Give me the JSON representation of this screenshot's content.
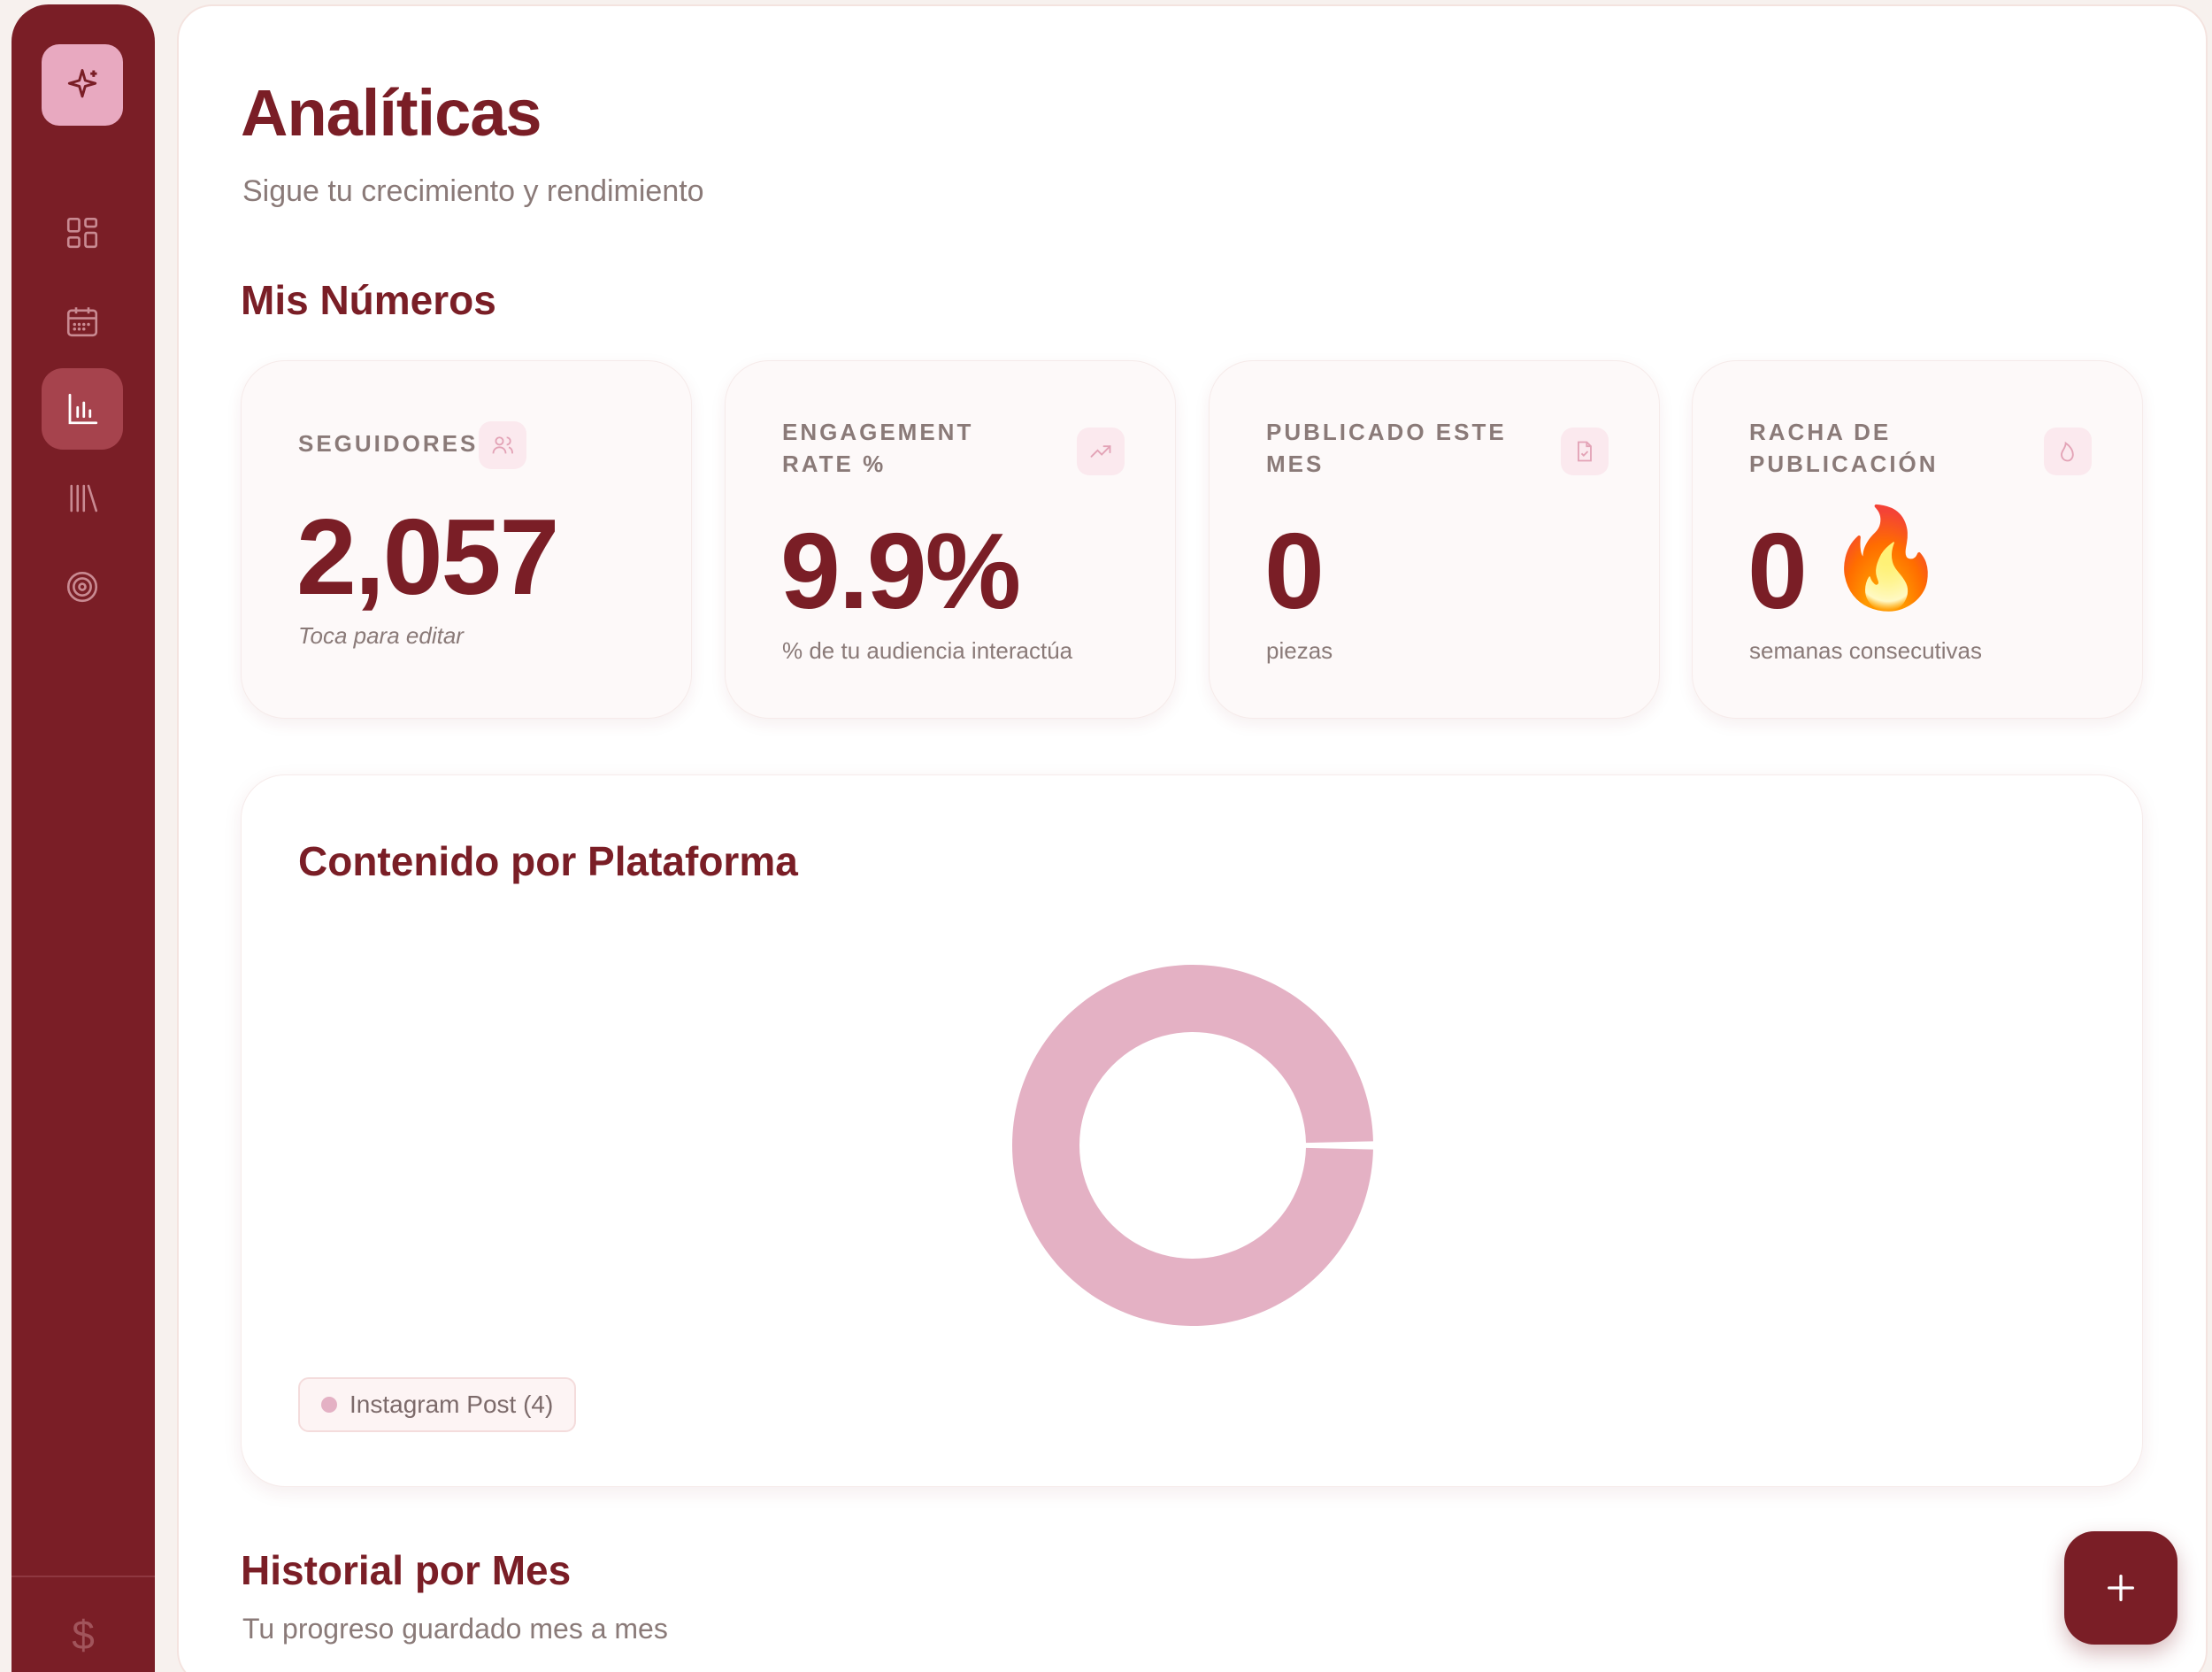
{
  "header": {
    "title": "Analíticas",
    "subtitle": "Sigue tu crecimiento y rendimiento"
  },
  "stats_section": {
    "title": "Mis Números"
  },
  "stats": [
    {
      "label": "SEGUIDORES",
      "value": "2,057",
      "foot": "Toca para editar",
      "icon": "users-icon"
    },
    {
      "label": "ENGAGEMENT RATE %",
      "value": "9.9%",
      "foot": "% de tu audiencia interactúa",
      "icon": "trending-up-icon"
    },
    {
      "label": "PUBLICADO ESTE MES",
      "value": "0",
      "foot": "piezas",
      "icon": "file-check-icon"
    },
    {
      "label": "RACHA DE PUBLICACIÓN",
      "value": "0",
      "foot": "semanas consecutivas",
      "icon": "flame-icon",
      "emoji": "🔥"
    }
  ],
  "platform_chart": {
    "title": "Contenido por Plataforma",
    "legend_label": "Instagram Post (4)"
  },
  "chart_data": {
    "type": "pie",
    "title": "Contenido por Plataforma",
    "categories": [
      "Instagram Post"
    ],
    "values": [
      4
    ],
    "colors": [
      "#e4b1c4"
    ],
    "legend": "bottom-left"
  },
  "history": {
    "title": "Historial por Mes",
    "subtitle": "Tu progreso guardado mes a mes"
  },
  "sidebar": {
    "items": [
      {
        "name": "dashboard",
        "icon": "grid-icon",
        "active": false
      },
      {
        "name": "calendar",
        "icon": "calendar-icon",
        "active": false
      },
      {
        "name": "analytics",
        "icon": "bar-chart-icon",
        "active": true
      },
      {
        "name": "library",
        "icon": "library-icon",
        "active": false
      },
      {
        "name": "goals",
        "icon": "target-icon",
        "active": false
      }
    ],
    "footer_symbol": "$"
  },
  "colors": {
    "brand": "#7a1e26",
    "accent_pink": "#e4b1c4",
    "muted_text": "#8a7a78"
  }
}
